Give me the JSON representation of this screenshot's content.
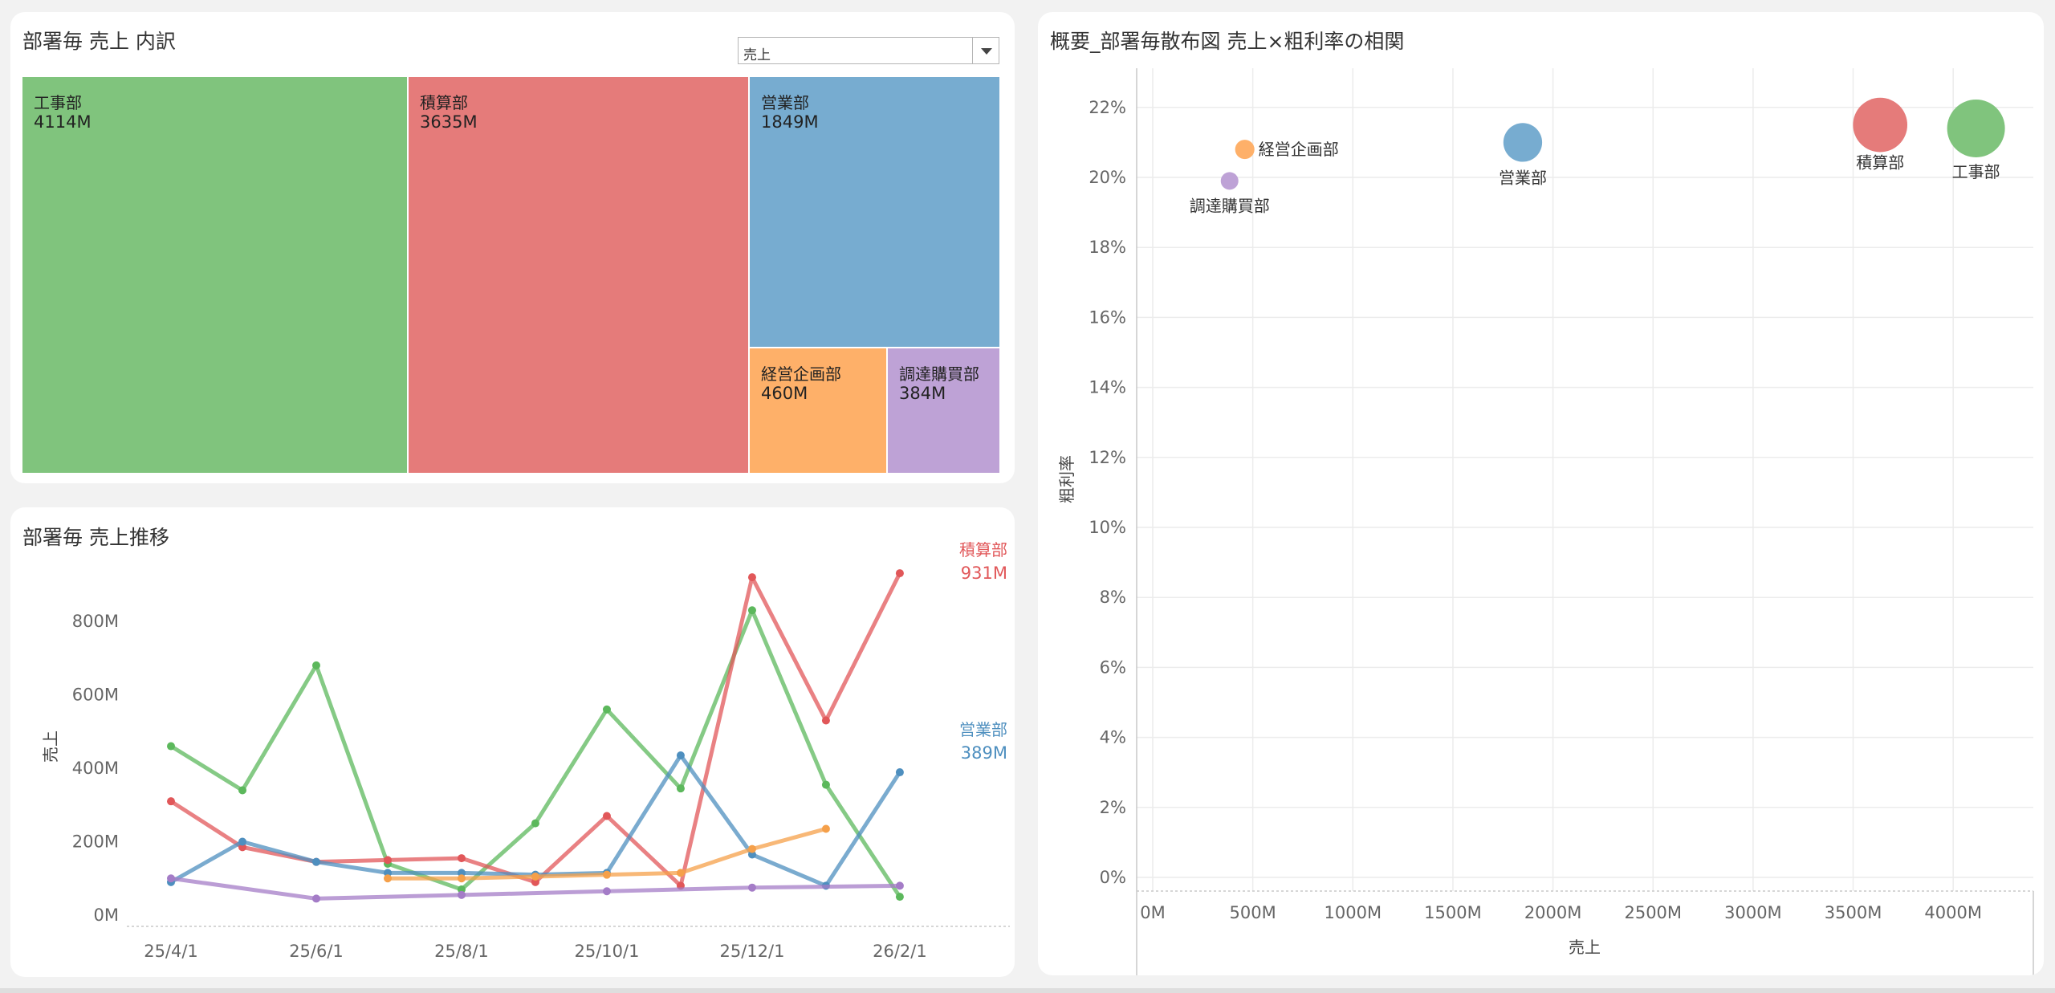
{
  "treemap_panel": {
    "title": "部署毎 売上 内訳",
    "dropdown_value": "売上",
    "tiles": [
      {
        "name": "工事部",
        "value_label": "4114M",
        "color": "#80c47d"
      },
      {
        "name": "積算部",
        "value_label": "3635M",
        "color": "#e57b7a"
      },
      {
        "name": "営業部",
        "value_label": "1849M",
        "color": "#77acd0"
      },
      {
        "name": "経営企画部",
        "value_label": "460M",
        "color": "#feb069"
      },
      {
        "name": "調達購買部",
        "value_label": "384M",
        "color": "#bea2d6"
      }
    ]
  },
  "line_panel": {
    "title": "部署毎 売上推移"
  },
  "scatter_panel": {
    "title": "概要_部署毎散布図 売上×粗利率の相関"
  },
  "chart_data": [
    {
      "type": "treemap",
      "title": "部署毎 売上 内訳",
      "categories": [
        "工事部",
        "積算部",
        "営業部",
        "経営企画部",
        "調達購買部"
      ],
      "values": [
        4114,
        3635,
        1849,
        460,
        384
      ],
      "labels": [
        "4114M",
        "3635M",
        "1849M",
        "460M",
        "384M"
      ]
    },
    {
      "type": "line",
      "title": "部署毎 売上推移",
      "ylabel": "売上",
      "ylim": [
        0,
        960
      ],
      "yticks": [
        0,
        200,
        400,
        600,
        800
      ],
      "ytick_labels": [
        "0M",
        "200M",
        "400M",
        "600M",
        "800M"
      ],
      "xticks": [
        "2025-04-01",
        "2025-06-01",
        "2025-08-01",
        "2025-10-01",
        "2025-12-01",
        "2026-02-01"
      ],
      "xtick_labels": [
        "25/4/1",
        "25/6/1",
        "25/8/1",
        "25/10/1",
        "25/12/1",
        "26/2/1"
      ],
      "grid": false,
      "series": [
        {
          "name": "工事部",
          "color": "#5cb85c",
          "points": [
            [
              "2025-04-01",
              460
            ],
            [
              "2025-05-01",
              340
            ],
            [
              "2025-06-01",
              680
            ],
            [
              "2025-07-01",
              140
            ],
            [
              "2025-08-01",
              70
            ],
            [
              "2025-09-01",
              250
            ],
            [
              "2025-10-01",
              560
            ],
            [
              "2025-11-01",
              345
            ],
            [
              "2025-12-01",
              830
            ],
            [
              "2026-01-01",
              355
            ],
            [
              "2026-02-01",
              50
            ]
          ]
        },
        {
          "name": "積算部",
          "color": "#e15759",
          "end_label": "積算部",
          "end_value_label": "931M",
          "points": [
            [
              "2025-04-01",
              310
            ],
            [
              "2025-05-01",
              185
            ],
            [
              "2025-06-01",
              145
            ],
            [
              "2025-07-01",
              150
            ],
            [
              "2025-08-01",
              155
            ],
            [
              "2025-09-01",
              90
            ],
            [
              "2025-10-01",
              270
            ],
            [
              "2025-11-01",
              80
            ],
            [
              "2025-12-01",
              920
            ],
            [
              "2026-01-01",
              530
            ],
            [
              "2026-02-01",
              931
            ]
          ]
        },
        {
          "name": "営業部",
          "color": "#4e8fbf",
          "end_label": "営業部",
          "end_value_label": "389M",
          "points": [
            [
              "2025-04-01",
              90
            ],
            [
              "2025-05-01",
              200
            ],
            [
              "2025-06-01",
              145
            ],
            [
              "2025-07-01",
              115
            ],
            [
              "2025-08-01",
              115
            ],
            [
              "2025-09-01",
              110
            ],
            [
              "2025-10-01",
              115
            ],
            [
              "2025-11-01",
              435
            ],
            [
              "2025-12-01",
              165
            ],
            [
              "2026-01-01",
              80
            ],
            [
              "2026-02-01",
              389
            ]
          ]
        },
        {
          "name": "経営企画部",
          "color": "#f5a04a",
          "points": [
            [
              "2025-07-01",
              100
            ],
            [
              "2025-08-01",
              100
            ],
            [
              "2025-09-01",
              105
            ],
            [
              "2025-10-01",
              110
            ],
            [
              "2025-11-01",
              115
            ],
            [
              "2025-12-01",
              180
            ],
            [
              "2026-01-01",
              235
            ]
          ]
        },
        {
          "name": "調達購買部",
          "color": "#a47cc7",
          "points": [
            [
              "2025-04-01",
              100
            ],
            [
              "2025-06-01",
              45
            ],
            [
              "2025-08-01",
              55
            ],
            [
              "2025-10-01",
              65
            ],
            [
              "2025-12-01",
              75
            ],
            [
              "2026-02-01",
              80
            ]
          ]
        }
      ]
    },
    {
      "type": "scatter",
      "title": "概要_部署毎散布図 売上×粗利率の相関",
      "xlabel": "売上",
      "ylabel": "粗利率",
      "xlim": [
        0,
        4500
      ],
      "ylim": [
        0,
        22.5
      ],
      "xticks": [
        0,
        500,
        1000,
        1500,
        2000,
        2500,
        3000,
        3500,
        4000
      ],
      "xtick_labels": [
        "0M",
        "500M",
        "1000M",
        "1500M",
        "2000M",
        "2500M",
        "3000M",
        "3500M",
        "4000M"
      ],
      "yticks": [
        0,
        2,
        4,
        6,
        8,
        10,
        12,
        14,
        16,
        18,
        20,
        22
      ],
      "ytick_labels": [
        "0%",
        "2%",
        "4%",
        "6%",
        "8%",
        "10%",
        "12%",
        "14%",
        "16%",
        "18%",
        "20%",
        "22%"
      ],
      "grid": true,
      "points": [
        {
          "name": "経営企画部",
          "x": 460,
          "y": 20.8,
          "color": "#feb069"
        },
        {
          "name": "調達購買部",
          "x": 384,
          "y": 19.9,
          "color": "#bea2d6"
        },
        {
          "name": "営業部",
          "x": 1849,
          "y": 21.0,
          "color": "#77acd0"
        },
        {
          "name": "積算部",
          "x": 3635,
          "y": 21.5,
          "color": "#e57b7a"
        },
        {
          "name": "工事部",
          "x": 4114,
          "y": 21.4,
          "color": "#80c47d"
        }
      ]
    }
  ]
}
